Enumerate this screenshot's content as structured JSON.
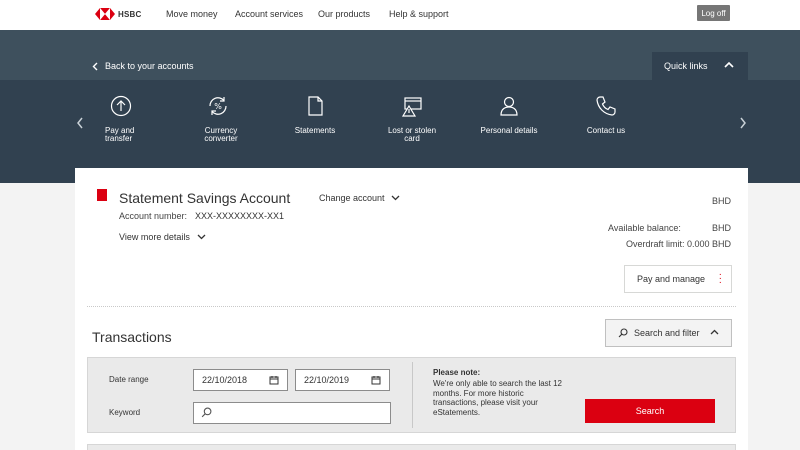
{
  "brand": {
    "name": "HSBC",
    "red": "#db0011",
    "dark_band": "#314150"
  },
  "topnav": {
    "links": [
      "Move money",
      "Account services",
      "Our products",
      "Help & support"
    ],
    "logoff": "Log off"
  },
  "header": {
    "back": "Back to your accounts",
    "quick_links": "Quick links"
  },
  "quick_links": [
    {
      "label": "Pay and transfer",
      "icon": "upload-circle-icon"
    },
    {
      "label": "Currency converter",
      "icon": "currency-converter-icon"
    },
    {
      "label": "Statements",
      "icon": "document-icon"
    },
    {
      "label": "Lost or stolen card",
      "icon": "card-warning-icon"
    },
    {
      "label": "Personal details",
      "icon": "person-icon"
    },
    {
      "label": "Contact us",
      "icon": "phone-icon"
    }
  ],
  "account": {
    "name": "Statement Savings Account",
    "change": "Change account",
    "number_label": "Account number:",
    "number": "XXX-XXXXXXXX-XX1",
    "view_more": "View more details",
    "currency": "BHD",
    "available_label": "Available balance:",
    "available_currency": "BHD",
    "overdraft": "Overdraft limit: 0.000 BHD",
    "pay_manage": "Pay and manage"
  },
  "transactions": {
    "title": "Transactions",
    "search_filter": "Search and filter",
    "date_range_label": "Date range",
    "date_from": "22/10/2018",
    "date_to": "22/10/2019",
    "keyword_label": "Keyword",
    "keyword_value": "",
    "note_title": "Please note:",
    "note_body": "We're only able to search the last 12 months. For more historic transactions, please visit your eStatements.",
    "search_button": "Search"
  }
}
